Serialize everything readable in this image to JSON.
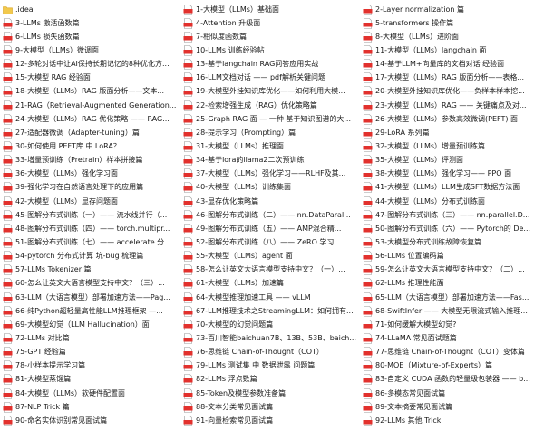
{
  "icons": {
    "folder": "folder-icon",
    "file": "pdf-file-icon"
  },
  "colors": {
    "folder": "#f2c94c",
    "pdf": "#e2312d",
    "text": "#1a1a1a"
  },
  "columns": [
    [
      {
        "type": "folder",
        "label": ".idea"
      },
      {
        "type": "file",
        "label": "3-LLMs 激活函数篇"
      },
      {
        "type": "file",
        "label": "6-LLMs 损失函数篇"
      },
      {
        "type": "file",
        "label": "9-大模型（LLMs）微调面"
      },
      {
        "type": "file",
        "label": "12-多轮对话中让AI保持长期记忆的8种优化方..."
      },
      {
        "type": "file",
        "label": "15-大模型 RAG 经验面"
      },
      {
        "type": "file",
        "label": "18-大模型（LLMs）RAG 版面分析——文本..."
      },
      {
        "type": "file",
        "label": "21-RAG（Retrieval-Augmented Generation..."
      },
      {
        "type": "file",
        "label": "24-大模型（LLMs）RAG 优化策略 —— RAG..."
      },
      {
        "type": "file",
        "label": "27-适配器微调（Adapter-tuning）篇"
      },
      {
        "type": "file",
        "label": "30-如何使用 PEFT库 中 LoRA？"
      },
      {
        "type": "file",
        "label": "33-增量预训练（Pretrain）样本拼接篇"
      },
      {
        "type": "file",
        "label": "36-大模型（LLMs）强化学习面"
      },
      {
        "type": "file",
        "label": "39-强化学习在自然语言处理下的应用篇"
      },
      {
        "type": "file",
        "label": "42-大模型（LLMs）显存问题面"
      },
      {
        "type": "file",
        "label": "45-图解分布式训练（一）—— 流水线并行（..."
      },
      {
        "type": "file",
        "label": "48-图解分布式训练（四）—— torch.multipr..."
      },
      {
        "type": "file",
        "label": "51-图解分布式训练（七）—— accelerate 分..."
      },
      {
        "type": "file",
        "label": "54-pytorch 分布式计算 坑-bug 梳理篇"
      },
      {
        "type": "file",
        "label": "57-LLMs Tokenizer 篇"
      },
      {
        "type": "file",
        "label": "60-怎么让英文大语言模型支持中文？（三）..."
      },
      {
        "type": "file",
        "label": "63-LLM（大语言模型）部署加速方法——Pag..."
      },
      {
        "type": "file",
        "label": "66-纯Python超轻量高性能LLM推理框架 —..."
      },
      {
        "type": "file",
        "label": "69-大模型幻觉（LLM Hallucination）面"
      },
      {
        "type": "file",
        "label": "72-LLMs 对比篇"
      },
      {
        "type": "file",
        "label": "75-GPT 经验篇"
      },
      {
        "type": "file",
        "label": "78-小样本提示学习篇"
      },
      {
        "type": "file",
        "label": "81-大模型蒸馏篇"
      },
      {
        "type": "file",
        "label": "84-大模型（LLMs）软硬件配置面"
      },
      {
        "type": "file",
        "label": "87-NLP Trick 篇"
      },
      {
        "type": "file",
        "label": "90-命名实体识别常见面试篇"
      }
    ],
    [
      {
        "type": "file",
        "label": "1-大模型（LLMs）基础面"
      },
      {
        "type": "file",
        "label": "4-Attention 升级面"
      },
      {
        "type": "file",
        "label": "7-相似度函数篇"
      },
      {
        "type": "file",
        "label": "10-LLMs 训练经验帖"
      },
      {
        "type": "file",
        "label": "13-基于langchain RAG问答应用实战"
      },
      {
        "type": "file",
        "label": "16-LLM文档对话 —— pdf解析关键问题"
      },
      {
        "type": "file",
        "label": "19-大模型外挂知识库优化——如何利用大模..."
      },
      {
        "type": "file",
        "label": "22-检索增强生成（RAG）优化策略篇"
      },
      {
        "type": "file",
        "label": "25-Graph RAG 面 — 一种 基于知识图谱的大..."
      },
      {
        "type": "file",
        "label": "28-提示学习（Prompting）篇"
      },
      {
        "type": "file",
        "label": "31-大模型（LLMs）推理面"
      },
      {
        "type": "file",
        "label": "34-基于lora的llama2二次预训练"
      },
      {
        "type": "file",
        "label": "37-大模型（LLMs）强化学习——RLHF及其..."
      },
      {
        "type": "file",
        "label": "40-大模型（LLMs）训练集面"
      },
      {
        "type": "file",
        "label": "43-显存优化策略篇"
      },
      {
        "type": "file",
        "label": "46-图解分布式训练（二）—— nn.DataParal..."
      },
      {
        "type": "file",
        "label": "49-图解分布式训练（五）—— AMP混合精..."
      },
      {
        "type": "file",
        "label": "52-图解分布式训练（八）—— ZeRO 学习"
      },
      {
        "type": "file",
        "label": "55-大模型（LLMs）agent 面"
      },
      {
        "type": "file",
        "label": "58-怎么让英文大语言模型支持中文？（一）..."
      },
      {
        "type": "file",
        "label": "61-大模型（LLMs）加速篇"
      },
      {
        "type": "file",
        "label": "64-大模型推理加速工具 —— vLLM"
      },
      {
        "type": "file",
        "label": "67-LLM推理技术之StreamingLLM：如何拥有..."
      },
      {
        "type": "file",
        "label": "70-大模型的幻觉问题篇"
      },
      {
        "type": "file",
        "label": "73-百川智能baichuan7B、13B、53B、baich..."
      },
      {
        "type": "file",
        "label": "76-思维链 Chain-of-Thought（COT）"
      },
      {
        "type": "file",
        "label": "79-LLMs 测试集 中 数据泄露 问题篇"
      },
      {
        "type": "file",
        "label": "82-LLMs 浮点数篇"
      },
      {
        "type": "file",
        "label": "85-Token及模型参数准备篇"
      },
      {
        "type": "file",
        "label": "88-文本分类常见面试篇"
      },
      {
        "type": "file",
        "label": "91-向量检索常见面试篇"
      }
    ],
    [
      {
        "type": "file",
        "label": "2-Layer normalization 篇"
      },
      {
        "type": "file",
        "label": "5-transformers 操作篇"
      },
      {
        "type": "file",
        "label": "8-大模型（LLMs）进阶面"
      },
      {
        "type": "file",
        "label": "11-大模型（LLMs）langchain 面"
      },
      {
        "type": "file",
        "label": "14-基于LLM+向量库的文档对话 经验面"
      },
      {
        "type": "file",
        "label": "17-大模型（LLMs）RAG 版面分析——表格..."
      },
      {
        "type": "file",
        "label": "20-大模型外挂知识库优化——负样本样本挖..."
      },
      {
        "type": "file",
        "label": "23-大模型（LLMs）RAG —— 关键痛点及对..."
      },
      {
        "type": "file",
        "label": "26-大模型（LLMs）参数高效微调(PEFT) 面"
      },
      {
        "type": "file",
        "label": "29-LoRA 系列篇"
      },
      {
        "type": "file",
        "label": "32-大模型（LLMs）增量预训练篇"
      },
      {
        "type": "file",
        "label": "35-大模型（LLMs）评测面"
      },
      {
        "type": "file",
        "label": "38-大模型（LLMs）强化学习—— PPO 面"
      },
      {
        "type": "file",
        "label": "41-大模型（LLMs）LLM生成SFT数据方法面"
      },
      {
        "type": "file",
        "label": "44-大模型（LLMs）分布式训练面"
      },
      {
        "type": "file",
        "label": "47-图解分布式训练（三）—— nn.parallel.D..."
      },
      {
        "type": "file",
        "label": "50-图解分布式训练（六）—— Pytorch的 De..."
      },
      {
        "type": "file",
        "label": "53-大模型分布式训练故障恢复篇"
      },
      {
        "type": "file",
        "label": "56-LLMs 位置编码篇"
      },
      {
        "type": "file",
        "label": "59-怎么让英文大语言模型支持中文？（二）..."
      },
      {
        "type": "file",
        "label": "62-LLMs 推理性能面"
      },
      {
        "type": "file",
        "label": "65-LLM（大语言模型）部署加速方法——Fas..."
      },
      {
        "type": "file",
        "label": "68-SwiftInfer —— 大模型无限流式输入推理..."
      },
      {
        "type": "file",
        "label": "71-如何缓解大模型幻觉?"
      },
      {
        "type": "file",
        "label": "74-LLaMA 常见面试题篇"
      },
      {
        "type": "file",
        "label": "77-思维链 Chain-of-Thought（COT）变体篇"
      },
      {
        "type": "file",
        "label": "80-MOE（Mixture-of-Experts）篇"
      },
      {
        "type": "file",
        "label": "83-自定义 CUDA 函数的轻量级包装器 —— b..."
      },
      {
        "type": "file",
        "label": "86-多模态常见面试篇"
      },
      {
        "type": "file",
        "label": "89-文本摘要常见面试篇"
      },
      {
        "type": "file",
        "label": "92-LLMs 其他 Trick"
      }
    ]
  ]
}
